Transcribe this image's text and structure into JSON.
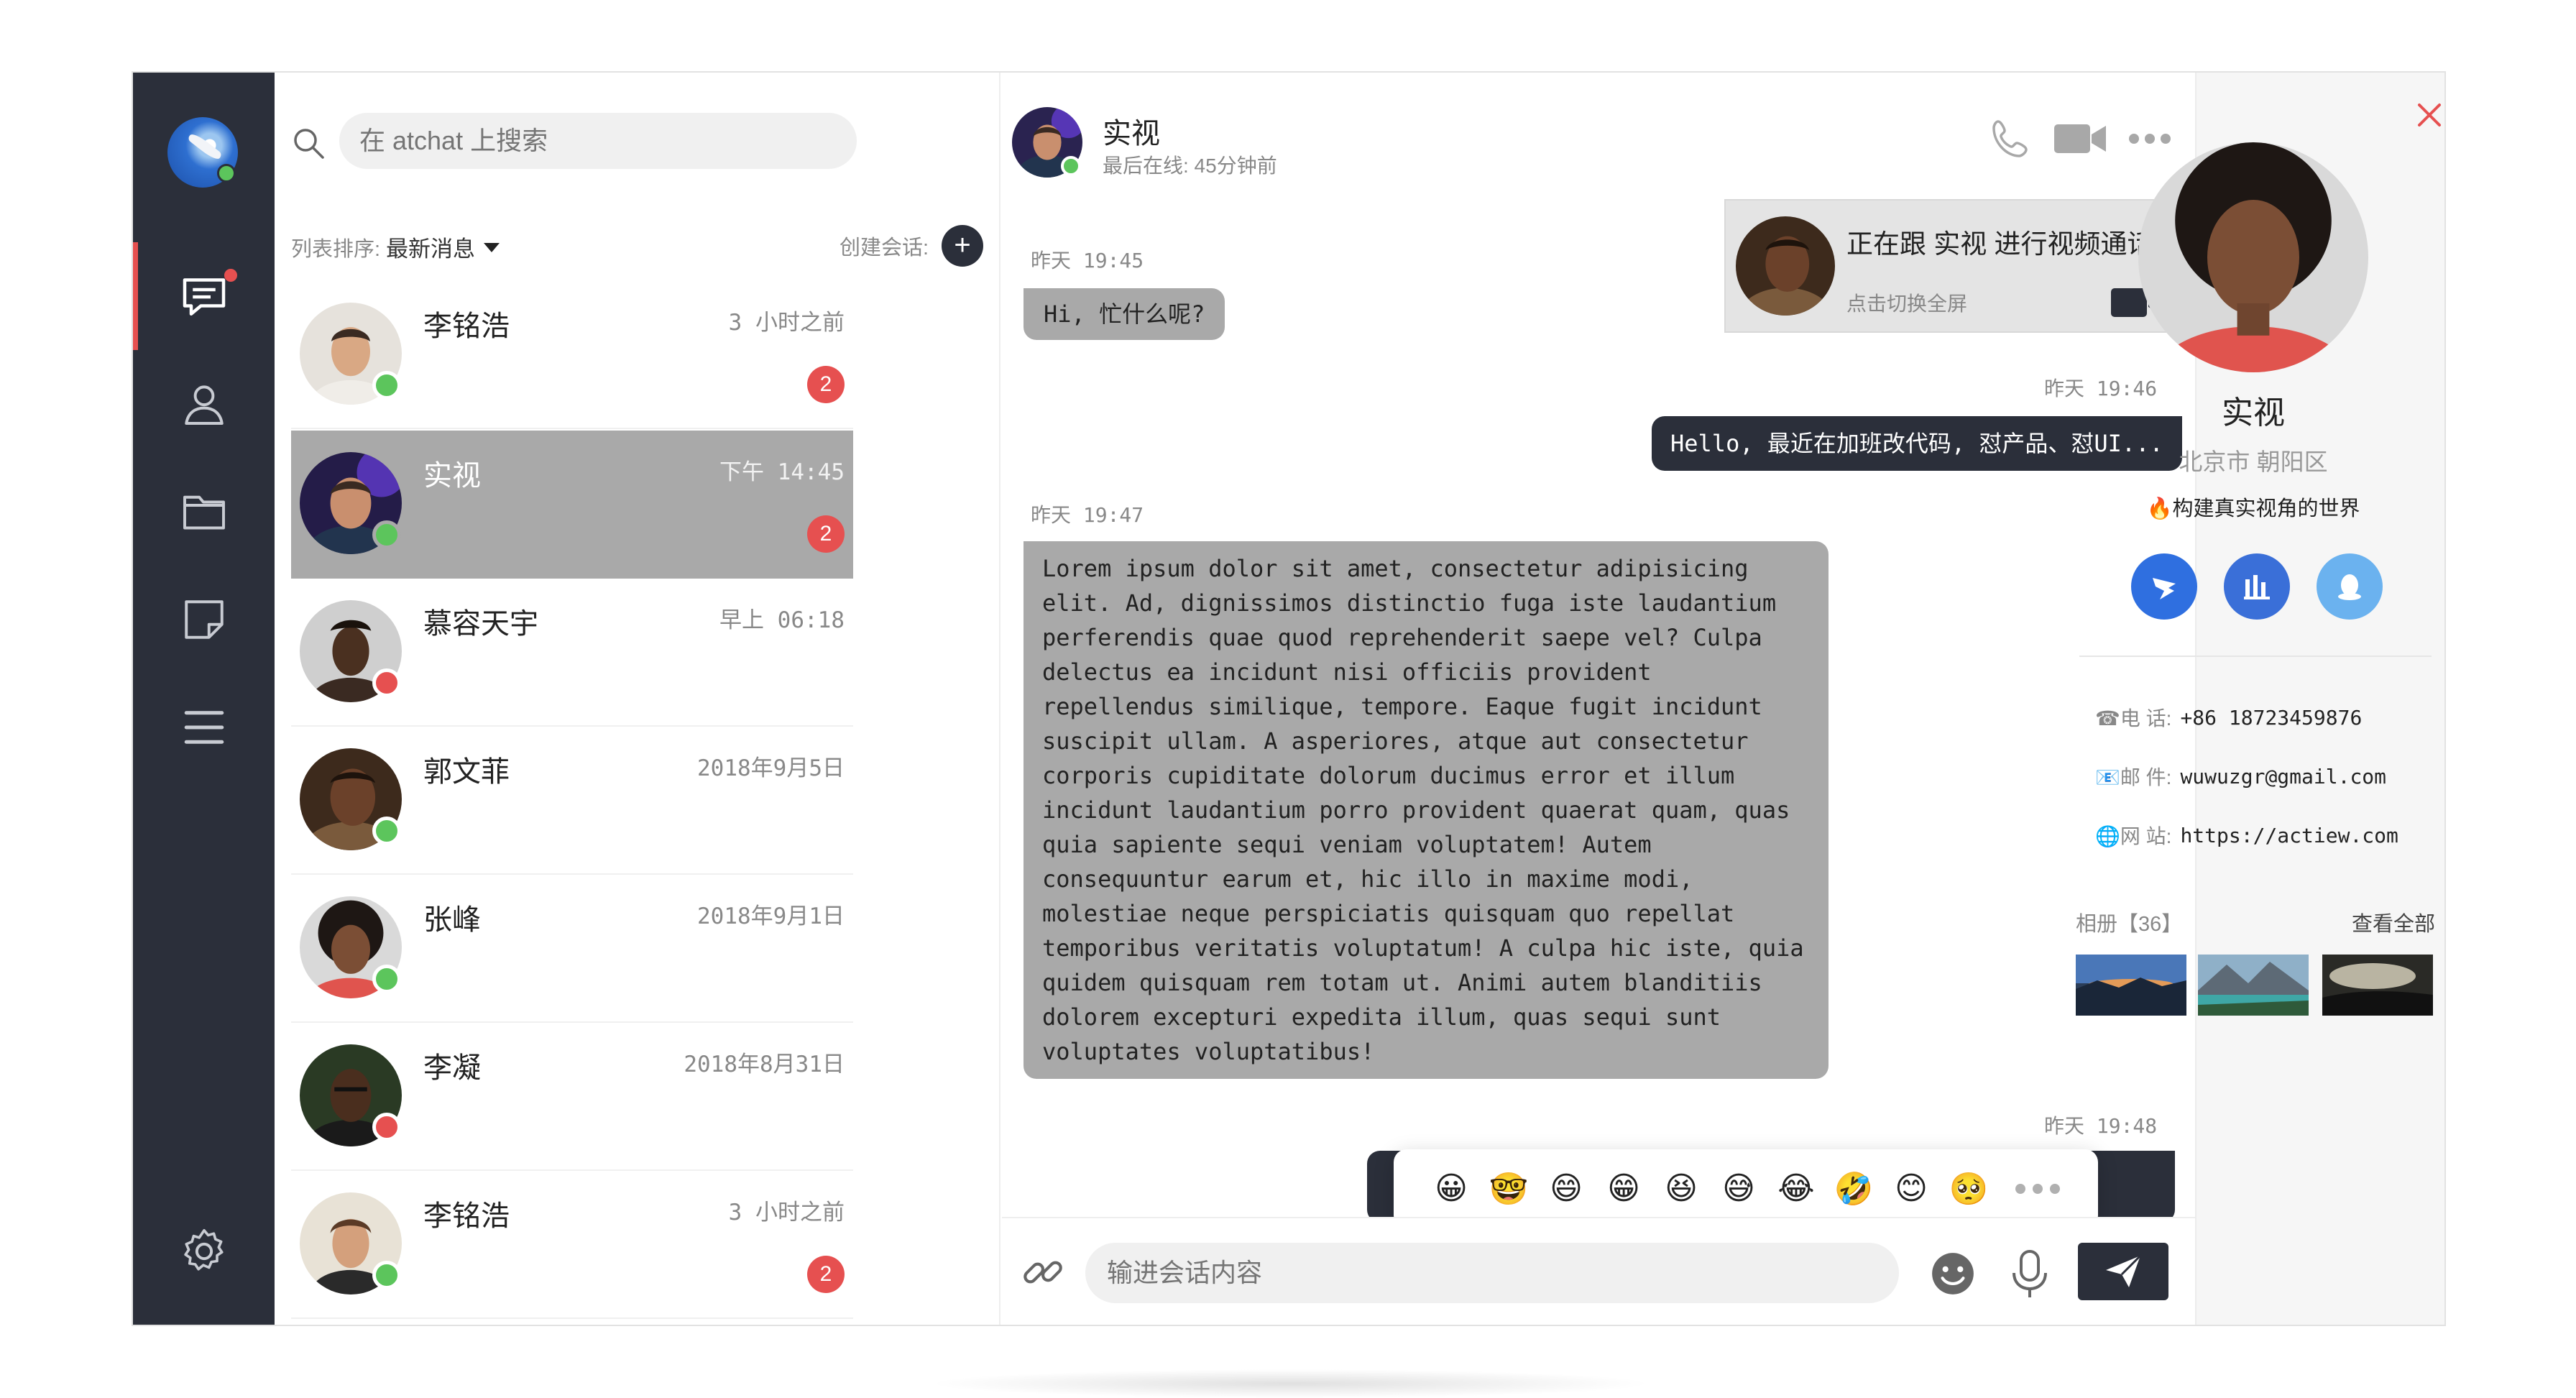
{
  "nav": {
    "items": [
      "chat-icon",
      "contacts-icon",
      "folder-icon",
      "notes-icon",
      "menu-icon"
    ],
    "settings": "gear-icon",
    "colors": {
      "rail": "#2b2f3a",
      "accent": "#e65050",
      "online": "#5cc55c"
    }
  },
  "list": {
    "search_placeholder": "在 atchat 上搜索",
    "sort_label": "列表排序:",
    "sort_value": "最新消息",
    "create_label": "创建会话:",
    "create_button": "+",
    "conversations": [
      {
        "name": "李铭浩",
        "time": "3 小时之前",
        "unread": "2",
        "status": "online"
      },
      {
        "name": "实视",
        "time": "下午 14:45",
        "unread": "2",
        "status": "online"
      },
      {
        "name": "慕容天宇",
        "time": "早上 06:18",
        "unread": "",
        "status": "busy"
      },
      {
        "name": "郭文菲",
        "time": "2018年9月5日",
        "unread": "",
        "status": "online"
      },
      {
        "name": "张峰",
        "time": "2018年9月1日",
        "unread": "",
        "status": "online"
      },
      {
        "name": "李凝",
        "time": "2018年8月31日",
        "unread": "",
        "status": "busy"
      },
      {
        "name": "李铭浩",
        "time": "3 小时之前",
        "unread": "2",
        "status": "online"
      }
    ]
  },
  "chat": {
    "name": "实视",
    "last_seen": "最后在线: 45分钟前",
    "video_card": {
      "title": "正在跟  实视  进行视频通话",
      "subtitle": "点击切换全屏"
    },
    "messages": [
      {
        "stamp": "昨天  19:45",
        "text": "Hi, 忙什么呢?",
        "dir": "in"
      },
      {
        "stamp": "昨天  19:46",
        "text": "Hello, 最近在加班改代码, 怼产品、怼UI...",
        "dir": "out"
      },
      {
        "stamp": "昨天  19:47",
        "text": "Lorem ipsum dolor sit amet, consectetur adipisicing\nelit. Ad, dignissimos distinctio fuga iste laudantium\nperferendis quae quod reprehenderit saepe vel? Culpa\ndelectus ea incidunt nisi officiis provident\nrepellendus similique, tempore. Eaque fugit incidunt\nsuscipit ullam. A asperiores, atque aut consectetur\ncorporis cupiditate dolorum ducimus error et illum\nincidunt laudantium porro provident quaerat quam, quas\nquia sapiente sequi veniam voluptatem! Autem\nconsequuntur earum et, hic illo in maxime modi,\nmolestiae neque perspiciatis quisquam quo repellat\ntemporibus veritatis voluptatum! A culpa hic iste, quia\nquidem quisquam rem totam ut. Animi autem blanditiis\ndolorem excepturi expedita illum, quas sequi sunt\nvoluptates voluptatibus!",
        "dir": "in"
      },
      {
        "stamp": "昨天  19:48",
        "text": "",
        "dir": "out"
      }
    ],
    "emojis": [
      "😀",
      "🤓",
      "😄",
      "😁",
      "😆",
      "😅",
      "😂",
      "🤣",
      "😊",
      "🥺"
    ],
    "input_placeholder": "输进会话内容"
  },
  "profile": {
    "name": "实视",
    "location": "北京市  朝阳区",
    "motto": "🔥构建真实视角的世界",
    "phone_label": "☎电  话:",
    "phone": "+86 18723459876",
    "email_label": "📧邮  件:",
    "email": "wuwuzgr@gmail.com",
    "site_label": "🌐网  站:",
    "site": "https://actiew.com",
    "album_label": "相册【36】",
    "album_all": "查看全部",
    "social_colors": [
      "#2f6fe0",
      "#3a6fd8",
      "#6bb2ef"
    ]
  }
}
